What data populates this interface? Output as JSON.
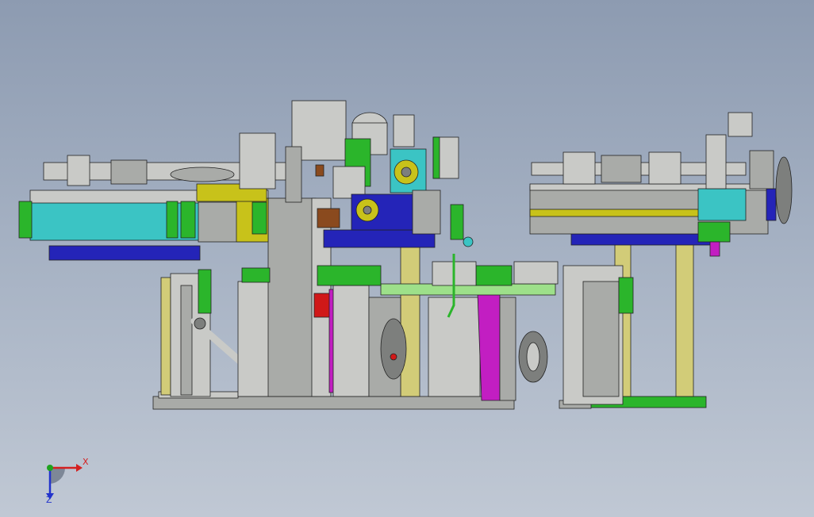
{
  "axis_triad": {
    "x_label": "X",
    "z_label": "Z",
    "x_color": "#d42020",
    "y_color": "#1fa31f",
    "z_color": "#2233cc"
  },
  "palette": {
    "frame_gray": "#a9aba8",
    "light_gray": "#c9cac7",
    "dark_gray": "#7d7f7d",
    "cyan": "#3bc4c4",
    "yellow": "#c8c21a",
    "blue": "#2424b8",
    "green": "#2bb52b",
    "light_green": "#9de08a",
    "olive_rod": "#d2cc78",
    "magenta": "#c21ec2",
    "red": "#d01818",
    "brown": "#8a4a1e",
    "outline": "#222222"
  }
}
